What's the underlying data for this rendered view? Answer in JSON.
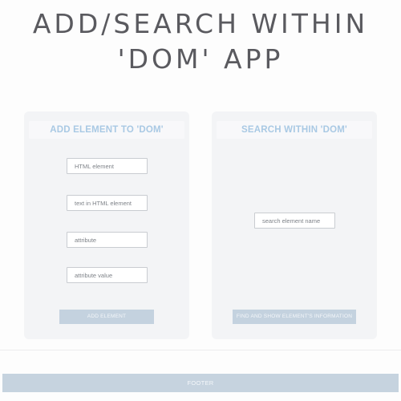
{
  "app": {
    "title": "ADD/SEARCH WITHIN 'DOM' APP"
  },
  "add_panel": {
    "title": "ADD ELEMENT TO 'DOM'",
    "fields": [
      {
        "placeholder": "HTML element",
        "value": ""
      },
      {
        "placeholder": "text in HTML element",
        "value": ""
      },
      {
        "placeholder": "attribute",
        "value": ""
      },
      {
        "placeholder": "attribute value",
        "value": ""
      }
    ],
    "button_label": "ADD ELEMENT"
  },
  "search_panel": {
    "title": "SEARCH WITHIN 'DOM'",
    "search_placeholder": "search element name",
    "search_value": "",
    "button_label": "FIND AND SHOW ELEMENT'S INFORMATION"
  },
  "footer": {
    "label": "FOOTER"
  },
  "colors": {
    "title_text": "#5a5a5f",
    "panel_bg": "#f3f4f6",
    "panel_title": "#a9c9e4",
    "button_bg": "#c4d2df",
    "footer_bg": "#c6d3df"
  }
}
